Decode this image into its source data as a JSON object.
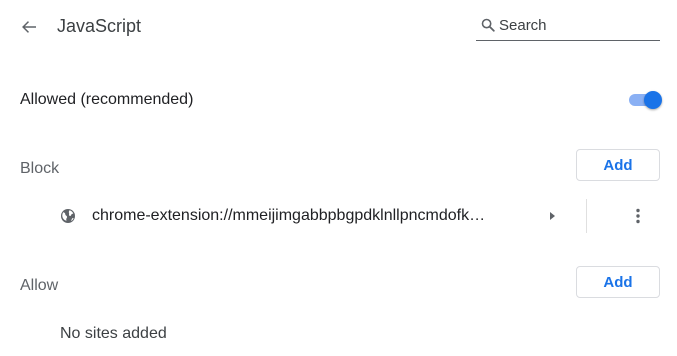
{
  "header": {
    "back_icon": "arrow-back-icon",
    "title": "JavaScript",
    "search": {
      "icon": "search-icon",
      "placeholder": "Search",
      "value": ""
    }
  },
  "allowed": {
    "label": "Allowed (recommended)",
    "toggle_on": true,
    "accent_color": "#1a73e8"
  },
  "block": {
    "heading": "Block",
    "add_label": "Add",
    "sites": [
      {
        "icon": "globe-icon",
        "name": "chrome-extension://mmeijimgabbpbgpdklnllpncmdofk…",
        "expand_icon": "arrow-right-icon",
        "menu_icon": "more-vert-icon"
      }
    ]
  },
  "allow": {
    "heading": "Allow",
    "add_label": "Add",
    "empty_text": "No sites added"
  }
}
